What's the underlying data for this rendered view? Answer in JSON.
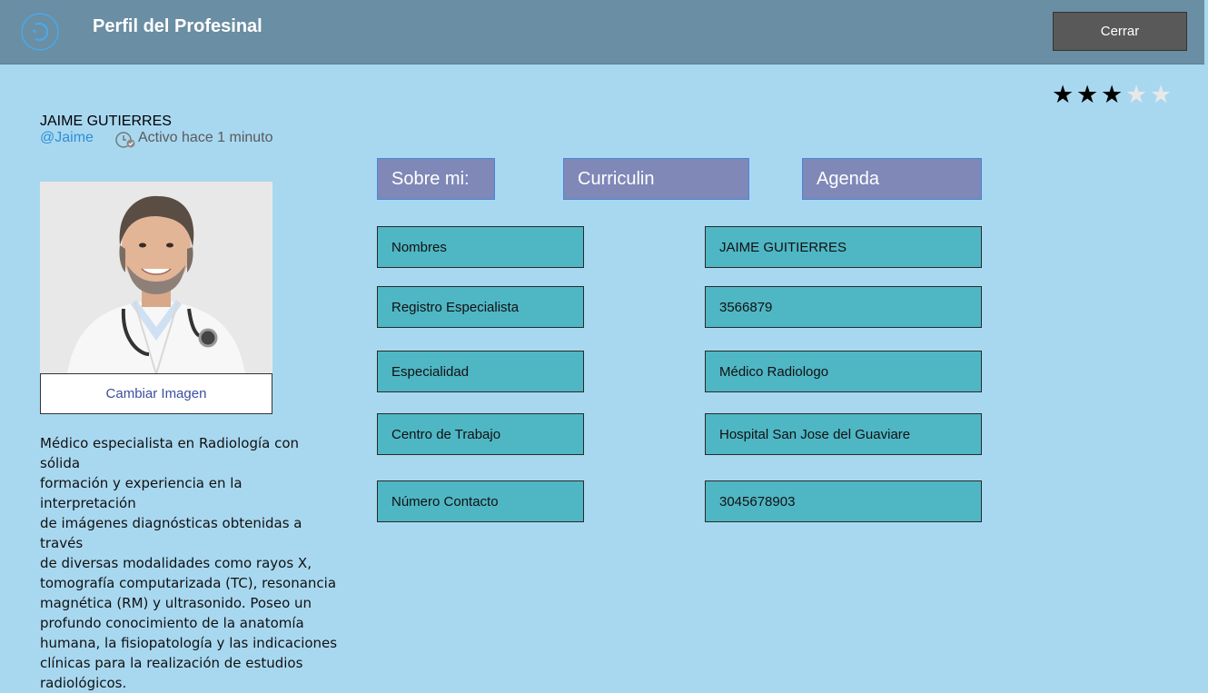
{
  "header": {
    "title": "Perfil del Profesinal",
    "close_label": "Cerrar",
    "logo_icon": "refresh-circle-icon"
  },
  "rating": {
    "value": 3,
    "max": 5
  },
  "profile": {
    "name": "JAIME GUTIERRES",
    "handle": "@Jaime",
    "status": "Activo hace 1 minuto",
    "change_image_label": "Cambiar Imagen",
    "bio": "Médico especialista en Radiología con sólida\n formación y experiencia en la interpretación\n de imágenes diagnósticas obtenidas a través\n de diversas modalidades como rayos X,\ntomografía computarizada (TC), resonancia\nmagnética (RM) y ultrasonido. Poseo un\n profundo conocimiento de la anatomía\nhumana, la fisiopatología y las indicaciones\n clínicas para la realización de estudios\nradiológicos."
  },
  "tabs": [
    {
      "label": "Sobre mi:"
    },
    {
      "label": "Curriculin"
    },
    {
      "label": "Agenda"
    }
  ],
  "fields": [
    {
      "label": "Nombres",
      "value": "JAIME GUITIERRES"
    },
    {
      "label": "Registro Especialista",
      "value": "3566879"
    },
    {
      "label": "Especialidad",
      "value": "Médico Radiologo"
    },
    {
      "label": "Centro de Trabajo",
      "value": "Hospital San Jose del Guaviare"
    },
    {
      "label": "Número Contacto",
      "value": "3045678903"
    }
  ],
  "colors": {
    "background": "#a8d8f0",
    "header": "#6a8ea3",
    "tab": "#8088b8",
    "field": "#4fb6c4",
    "link": "#2f8fd6"
  }
}
